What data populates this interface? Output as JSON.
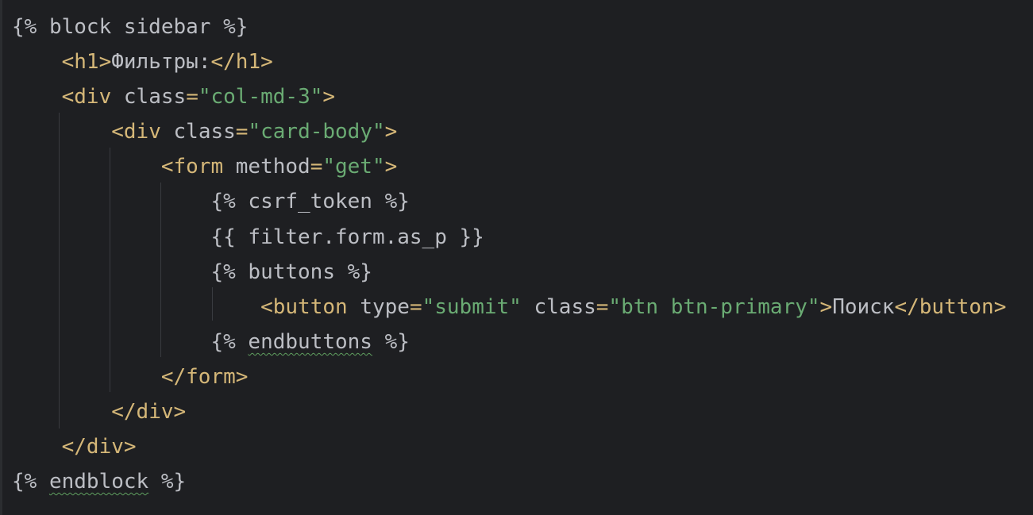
{
  "editor": {
    "lines": [
      {
        "indent": "",
        "tokens": [
          {
            "cls": "tpl",
            "text": "{% block sidebar %}"
          }
        ]
      },
      {
        "indent": "    ",
        "tokens": [
          {
            "cls": "tag",
            "text": "<h1>"
          },
          {
            "cls": "txt",
            "text": "Фильтры:"
          },
          {
            "cls": "tag",
            "text": "</h1>"
          }
        ]
      },
      {
        "indent": "    ",
        "tokens": [
          {
            "cls": "tag",
            "text": "<div "
          },
          {
            "cls": "attr",
            "text": "class"
          },
          {
            "cls": "tag",
            "text": "="
          },
          {
            "cls": "str",
            "text": "\"col-md-3\""
          },
          {
            "cls": "tag",
            "text": ">"
          }
        ]
      },
      {
        "indent": "        ",
        "tokens": [
          {
            "cls": "tag",
            "text": "<div "
          },
          {
            "cls": "attr",
            "text": "class"
          },
          {
            "cls": "tag",
            "text": "="
          },
          {
            "cls": "str",
            "text": "\"card-body\""
          },
          {
            "cls": "tag",
            "text": ">"
          }
        ]
      },
      {
        "indent": "            ",
        "tokens": [
          {
            "cls": "tag",
            "text": "<form "
          },
          {
            "cls": "attr",
            "text": "method"
          },
          {
            "cls": "tag",
            "text": "="
          },
          {
            "cls": "str",
            "text": "\"get\""
          },
          {
            "cls": "tag",
            "text": ">"
          }
        ]
      },
      {
        "indent": "                ",
        "tokens": [
          {
            "cls": "tpl",
            "text": "{% csrf_token %}"
          }
        ]
      },
      {
        "indent": "                ",
        "tokens": [
          {
            "cls": "tpl",
            "text": "{{ filter.form.as_p }}"
          }
        ]
      },
      {
        "indent": "                ",
        "tokens": [
          {
            "cls": "tpl",
            "text": "{% buttons %}"
          }
        ]
      },
      {
        "indent": "                    ",
        "tokens": [
          {
            "cls": "tag",
            "text": "<button "
          },
          {
            "cls": "attr",
            "text": "type"
          },
          {
            "cls": "tag",
            "text": "="
          },
          {
            "cls": "str",
            "text": "\"submit\""
          },
          {
            "cls": "txt",
            "text": " "
          },
          {
            "cls": "attr",
            "text": "class"
          },
          {
            "cls": "tag",
            "text": "="
          },
          {
            "cls": "str",
            "text": "\"btn btn-primary\""
          },
          {
            "cls": "tag",
            "text": ">"
          },
          {
            "cls": "txt",
            "text": "Поиск"
          },
          {
            "cls": "tag",
            "text": "</button>"
          }
        ]
      },
      {
        "indent": "                ",
        "tokens": [
          {
            "cls": "tpl",
            "text": "{% "
          },
          {
            "cls": "tpl warn",
            "text": "endbuttons"
          },
          {
            "cls": "tpl",
            "text": " %}"
          }
        ]
      },
      {
        "indent": "            ",
        "tokens": [
          {
            "cls": "tag",
            "text": "</form>"
          }
        ]
      },
      {
        "indent": "        ",
        "tokens": [
          {
            "cls": "tag",
            "text": "</div>"
          }
        ]
      },
      {
        "indent": "    ",
        "tokens": [
          {
            "cls": "tag",
            "text": "</div>"
          }
        ]
      },
      {
        "indent": "",
        "tokens": [
          {
            "cls": "tpl",
            "text": "{% "
          },
          {
            "cls": "tpl warn",
            "text": "endblock"
          },
          {
            "cls": "tpl",
            "text": " %}"
          }
        ]
      }
    ],
    "colors": {
      "background": "#1e1f22",
      "tag": "#d5b778",
      "string": "#6aab73",
      "text": "#bcbec4",
      "indent_guide": "#393b40",
      "warning_underline": "#5f9f5f"
    }
  }
}
